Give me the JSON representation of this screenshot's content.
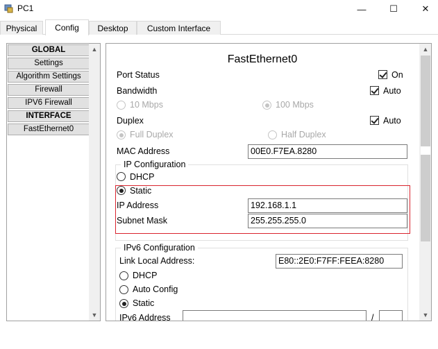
{
  "window": {
    "title": "PC1",
    "minimize_glyph": "—",
    "maximize_glyph": "☐",
    "close_glyph": "✕"
  },
  "tabs": [
    {
      "label": "Physical"
    },
    {
      "label": "Config"
    },
    {
      "label": "Desktop"
    },
    {
      "label": "Custom Interface"
    }
  ],
  "active_tab": "Config",
  "nav": {
    "items": [
      {
        "label": "GLOBAL"
      },
      {
        "label": "Settings"
      },
      {
        "label": "Algorithm Settings"
      },
      {
        "label": "Firewall"
      },
      {
        "label": "IPV6 Firewall"
      },
      {
        "label": "INTERFACE"
      },
      {
        "label": "FastEthernet0"
      }
    ]
  },
  "panel": {
    "title": "FastEthernet0",
    "port_status": {
      "label": "Port Status",
      "checkbox_label": "On",
      "checked": true
    },
    "bandwidth": {
      "label": "Bandwidth",
      "checkbox_label": "Auto",
      "checked": true,
      "option_10": "10 Mbps",
      "option_100": "100 Mbps",
      "selected": "100 Mbps"
    },
    "duplex": {
      "label": "Duplex",
      "checkbox_label": "Auto",
      "checked": true,
      "option_full": "Full Duplex",
      "option_half": "Half Duplex",
      "selected": "Full Duplex"
    },
    "mac": {
      "label": "MAC Address",
      "value": "00E0.F7EA.8280"
    },
    "ipv4": {
      "caption": "IP Configuration",
      "dhcp_label": "DHCP",
      "static_label": "Static",
      "selected": "Static",
      "ip_label": "IP Address",
      "ip_value": "192.168.1.1",
      "mask_label": "Subnet Mask",
      "mask_value": "255.255.255.0"
    },
    "ipv6": {
      "caption": "IPv6 Configuration",
      "link_local_label": "Link Local Address:",
      "link_local_value": "E80::2E0:F7FF:FEEA:8280",
      "dhcp_label": "DHCP",
      "auto_label": "Auto Config",
      "static_label": "Static",
      "selected": "Static",
      "address_label": "IPv6 Address",
      "address_value": "",
      "slash": "/",
      "prefix_value": ""
    }
  },
  "colors": {
    "highlight_border": "#d9232d",
    "tab_border": "#d9d9d9",
    "disabled_text": "#a8a8a8"
  }
}
